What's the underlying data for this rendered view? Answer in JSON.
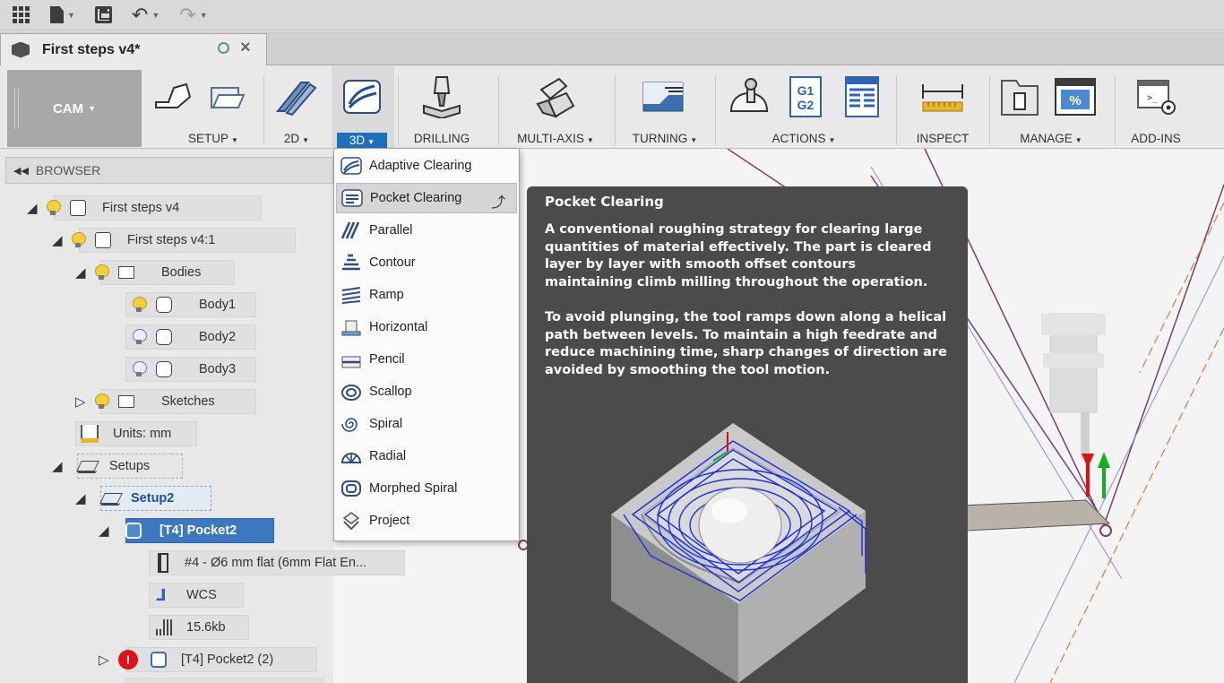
{
  "document": {
    "tab_title": "First steps v4*"
  },
  "ribbon": {
    "workspace": "CAM",
    "groups": {
      "setup": "SETUP",
      "2d": "2D",
      "3d": "3D",
      "drilling": "DRILLING",
      "multi_axis": "MULTI-AXIS",
      "turning": "TURNING",
      "actions": "ACTIONS",
      "inspect": "INSPECT",
      "manage": "MANAGE",
      "add_ins": "ADD-INS"
    },
    "gcode_icon_text": [
      "G1",
      "G2"
    ],
    "percent_icon_text": "%",
    "addins_icon_text": ">_"
  },
  "browser": {
    "title": "BROWSER",
    "nodes": {
      "root": "First steps v4",
      "component": "First steps v4:1",
      "bodies": "Bodies",
      "body1": "Body1",
      "body2": "Body2",
      "body3": "Body3",
      "sketches": "Sketches",
      "units": "Units: mm",
      "setups": "Setups",
      "setup2": "Setup2",
      "pocket2": "[T4] Pocket2",
      "tool": "#4 - Ø6 mm flat (6mm Flat En...",
      "wcs": "WCS",
      "nc_size": "15.6kb",
      "pocket2_copy": "[T4] Pocket2 (2)"
    }
  },
  "menu_3d": {
    "items": [
      {
        "label": "Adaptive Clearing",
        "icon": "adaptive-clearing-icon"
      },
      {
        "label": "Pocket Clearing",
        "icon": "pocket-clearing-icon"
      },
      {
        "label": "Parallel",
        "icon": "parallel-icon"
      },
      {
        "label": "Contour",
        "icon": "contour-icon"
      },
      {
        "label": "Ramp",
        "icon": "ramp-icon"
      },
      {
        "label": "Horizontal",
        "icon": "horizontal-icon"
      },
      {
        "label": "Pencil",
        "icon": "pencil-icon"
      },
      {
        "label": "Scallop",
        "icon": "scallop-icon"
      },
      {
        "label": "Spiral",
        "icon": "spiral-icon"
      },
      {
        "label": "Radial",
        "icon": "radial-icon"
      },
      {
        "label": "Morphed Spiral",
        "icon": "morphed-spiral-icon"
      },
      {
        "label": "Project",
        "icon": "project-icon"
      }
    ],
    "highlighted": "Pocket Clearing"
  },
  "tooltip": {
    "title": "Pocket Clearing",
    "paragraph1": "A conventional roughing strategy for clearing large quantities of material effectively. The part is cleared layer by layer with smooth offset contours maintaining climb milling throughout the operation.",
    "paragraph2": "To avoid plunging, the tool ramps down along a helical path between levels. To maintain a high feedrate and reduce machining time, sharp changes of direction are avoided by smoothing the tool motion."
  },
  "colors": {
    "accent": "#1f6fbd",
    "tooltip_bg": "#4b4b4b",
    "toolpath": "#1a2ee0",
    "error": "#e0101a",
    "bulb_on": "#f3d03b"
  }
}
